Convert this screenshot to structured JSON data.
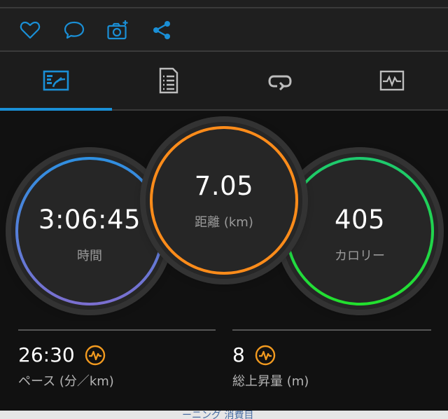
{
  "actions": {
    "like_icon": "heart-icon",
    "comment_icon": "speech-bubble-icon",
    "photo_icon": "camera-add-icon",
    "share_icon": "share-icon",
    "accent_color": "#1a8fd6"
  },
  "tabs": [
    {
      "icon": "stats-chart-icon",
      "active": true
    },
    {
      "icon": "details-document-icon",
      "active": false
    },
    {
      "icon": "laps-loop-icon",
      "active": false
    },
    {
      "icon": "graph-monitor-icon",
      "active": false
    }
  ],
  "rings": {
    "time": {
      "value": "3:06:45",
      "label": "時間",
      "colors": [
        "#2f8fe0",
        "#7b6fd0"
      ]
    },
    "distance": {
      "value": "7.05",
      "label": "距離 (km)",
      "color": "#ff8c1a"
    },
    "calories": {
      "value": "405",
      "label": "カロリー",
      "colors": [
        "#1ec96e",
        "#22e02e"
      ]
    }
  },
  "stats": {
    "pace": {
      "value": "26:30",
      "label": "ペース (分／km)",
      "icon": "heart-rate-badge-icon"
    },
    "ascent": {
      "value": "8",
      "label": "総上昇量 (m)",
      "icon": "heart-rate-badge-icon"
    },
    "badge_color": "#f29a1f"
  },
  "footer": {
    "text": "ーニング 消費目"
  }
}
